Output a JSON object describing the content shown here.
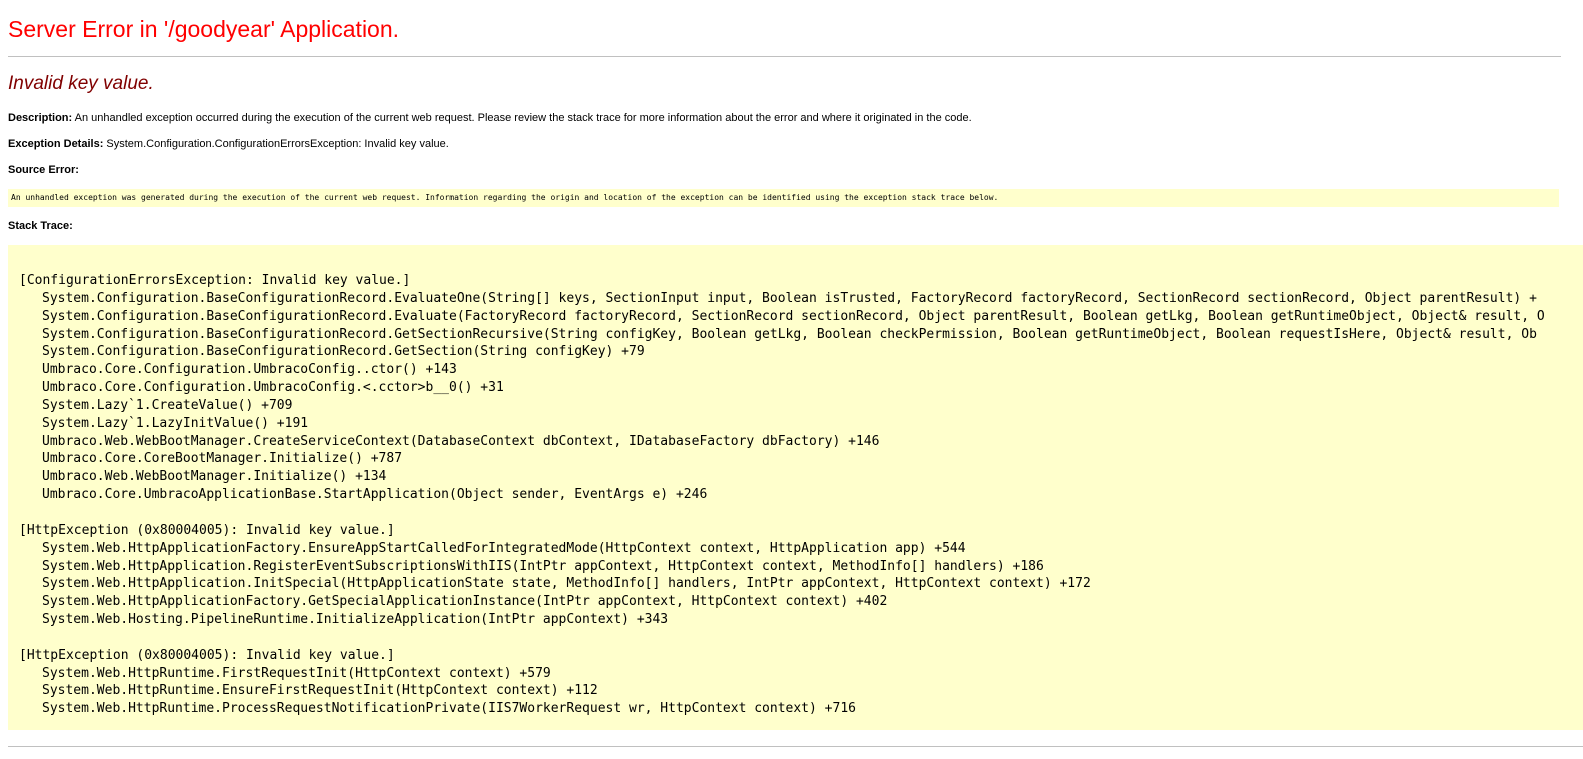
{
  "page": {
    "title": "Server Error in '/goodyear' Application.",
    "subtitle": "Invalid key value.",
    "description_label": "Description:",
    "description_text": " An unhandled exception occurred during the execution of the current web request. Please review the stack trace for more information about the error and where it originated in the code.",
    "exception_label": "Exception Details:",
    "exception_text": " System.Configuration.ConfigurationErrorsException: Invalid key value.",
    "source_error_label": "Source Error:",
    "source_error_text": "An unhandled exception was generated during the execution of the current web request. Information regarding the origin and location of the exception can be identified using the exception stack trace below.",
    "stack_trace_label": "Stack Trace:"
  },
  "stack_trace": {
    "sections": [
      {
        "header": "[ConfigurationErrorsException: Invalid key value.]",
        "frames": [
          "System.Configuration.BaseConfigurationRecord.EvaluateOne(String[] keys, SectionInput input, Boolean isTrusted, FactoryRecord factoryRecord, SectionRecord sectionRecord, Object parentResult) +",
          "System.Configuration.BaseConfigurationRecord.Evaluate(FactoryRecord factoryRecord, SectionRecord sectionRecord, Object parentResult, Boolean getLkg, Boolean getRuntimeObject, Object& result, O",
          "System.Configuration.BaseConfigurationRecord.GetSectionRecursive(String configKey, Boolean getLkg, Boolean checkPermission, Boolean getRuntimeObject, Boolean requestIsHere, Object& result, Ob",
          "System.Configuration.BaseConfigurationRecord.GetSection(String configKey) +79",
          "Umbraco.Core.Configuration.UmbracoConfig..ctor() +143",
          "Umbraco.Core.Configuration.UmbracoConfig.<.cctor>b__0() +31",
          "System.Lazy`1.CreateValue() +709",
          "System.Lazy`1.LazyInitValue() +191",
          "Umbraco.Web.WebBootManager.CreateServiceContext(DatabaseContext dbContext, IDatabaseFactory dbFactory) +146",
          "Umbraco.Core.CoreBootManager.Initialize() +787",
          "Umbraco.Web.WebBootManager.Initialize() +134",
          "Umbraco.Core.UmbracoApplicationBase.StartApplication(Object sender, EventArgs e) +246"
        ]
      },
      {
        "header": "[HttpException (0x80004005): Invalid key value.]",
        "frames": [
          "System.Web.HttpApplicationFactory.EnsureAppStartCalledForIntegratedMode(HttpContext context, HttpApplication app) +544",
          "System.Web.HttpApplication.RegisterEventSubscriptionsWithIIS(IntPtr appContext, HttpContext context, MethodInfo[] handlers) +186",
          "System.Web.HttpApplication.InitSpecial(HttpApplicationState state, MethodInfo[] handlers, IntPtr appContext, HttpContext context) +172",
          "System.Web.HttpApplicationFactory.GetSpecialApplicationInstance(IntPtr appContext, HttpContext context) +402",
          "System.Web.Hosting.PipelineRuntime.InitializeApplication(IntPtr appContext) +343"
        ]
      },
      {
        "header": "[HttpException (0x80004005): Invalid key value.]",
        "frames": [
          "System.Web.HttpRuntime.FirstRequestInit(HttpContext context) +579",
          "System.Web.HttpRuntime.EnsureFirstRequestInit(HttpContext context) +112",
          "System.Web.HttpRuntime.ProcessRequestNotificationPrivate(IIS7WorkerRequest wr, HttpContext context) +716"
        ]
      }
    ]
  },
  "colors": {
    "title": "#ff0000",
    "subtitle": "#800000",
    "code_background": "#ffffcc",
    "rule": "#c0c0c0"
  }
}
